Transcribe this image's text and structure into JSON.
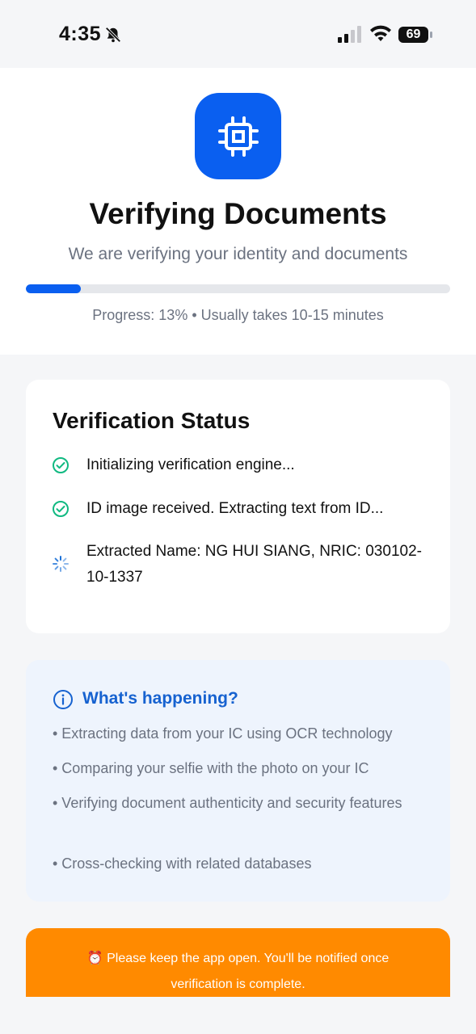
{
  "status_bar": {
    "time": "4:35",
    "battery": "69"
  },
  "header": {
    "title": "Verifying Documents",
    "subtitle": "We are verifying your identity and documents",
    "progress_percent": 13,
    "progress_text": "Progress: 13% • Usually takes 10-15 minutes",
    "accent_color": "#0a5ff0"
  },
  "verification": {
    "title": "Verification Status",
    "steps": [
      {
        "label": "Initializing verification engine...",
        "state": "done"
      },
      {
        "label": "ID image received. Extracting text from ID...",
        "state": "done"
      },
      {
        "label": "Extracted Name: NG HUI SIANG, NRIC: 030102-10-1337",
        "state": "in-progress"
      }
    ],
    "done_color": "#10b981"
  },
  "info": {
    "title": "What's happening?",
    "items": [
      "• Extracting data from your IC using OCR technology",
      "• Comparing your selfie with the photo on your IC",
      "• Verifying document authenticity and security features",
      "• Cross-checking with related databases"
    ]
  },
  "banner": {
    "text": "⏰ Please keep the app open. You'll be notified once verification is complete.",
    "color": "#ff8a00"
  }
}
